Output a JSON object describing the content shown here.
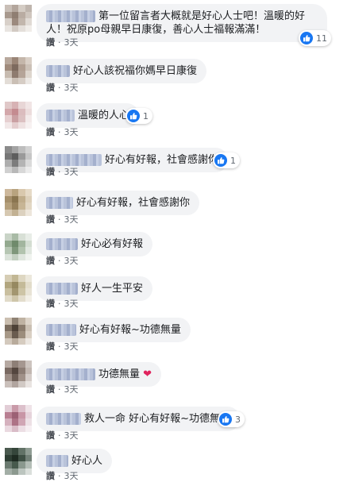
{
  "ui": {
    "like_label": "讚",
    "dot": "·"
  },
  "comments": [
    {
      "text": "第一位留言者大概就是好心人士吧！溫暖的好人！祝原po母親早日康復，善心人士福報滿滿！",
      "reactions": "11",
      "time": "3天"
    },
    {
      "text": "好心人該祝福你媽早日康復",
      "time": "3天"
    },
    {
      "text": "溫暖的人心",
      "reactions": "1",
      "time": "3天"
    },
    {
      "text": "好心有好報，社會感謝你",
      "reactions": "1",
      "time": "3天"
    },
    {
      "text": "好心有好報，社會感謝你",
      "time": "3天"
    },
    {
      "text": "好心必有好報",
      "time": "3天"
    },
    {
      "text": "好人一生平安",
      "time": "3天"
    },
    {
      "text": "好心有好報~功德無量",
      "time": "3天"
    },
    {
      "text": "功德無量",
      "time": "3天"
    },
    {
      "text": "救人一命 好心有好報~功德無量",
      "reactions": "3",
      "time": "3天"
    },
    {
      "text": "好心人",
      "time": "3天"
    }
  ]
}
